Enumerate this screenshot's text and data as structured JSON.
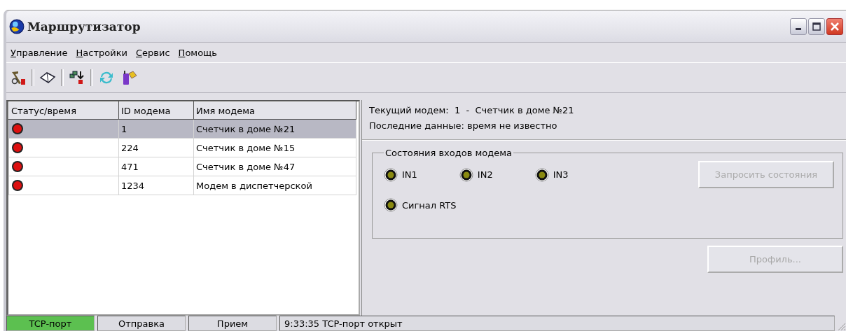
{
  "window": {
    "title": "Маршрутизатор"
  },
  "menu": [
    {
      "label": "Управление"
    },
    {
      "label": "Настройки"
    },
    {
      "label": "Сервис"
    },
    {
      "label": "Помощь"
    }
  ],
  "table": {
    "columns": [
      "Статус/время",
      "ID модема",
      "Имя модема"
    ],
    "rows": [
      {
        "selected": true,
        "color": "#dd1010",
        "id": "1",
        "name": "Счетчик в доме №21"
      },
      {
        "selected": false,
        "color": "#dd1010",
        "id": "224",
        "name": "Счетчик в доме №15"
      },
      {
        "selected": false,
        "color": "#dd1010",
        "id": "471",
        "name": "Счетчик в доме №47"
      },
      {
        "selected": false,
        "color": "#dd1010",
        "id": "1234",
        "name": "Модем в диспетчерской"
      }
    ]
  },
  "details": {
    "current": "Текущий модем:  1  -  Счетчик в доме №21",
    "last": "Последние данные: время не известно",
    "group": {
      "title": "Состояния входов модема",
      "inputs": [
        {
          "label": "IN1",
          "on": false
        },
        {
          "label": "IN2",
          "on": false
        },
        {
          "label": "IN3",
          "on": false
        }
      ],
      "rts": {
        "label": "Сигнал RTS",
        "on": false
      },
      "request_button": {
        "label": "Запросить состояния",
        "disabled": true
      }
    },
    "profile_button": {
      "label": "Профиль...",
      "disabled": true
    }
  },
  "status_bar": {
    "panels": [
      {
        "label": "TCP-порт",
        "on": true
      },
      {
        "label": "Отправка",
        "on": false
      },
      {
        "label": "Прием",
        "on": false
      }
    ],
    "message": "9:33:35  TCP-порт открыт"
  }
}
